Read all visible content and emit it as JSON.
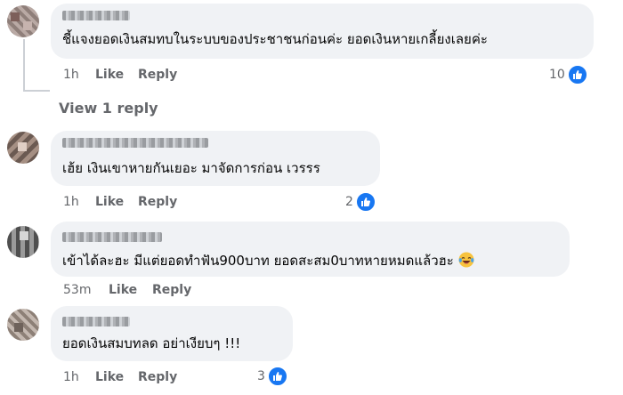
{
  "comments": [
    {
      "text": "ชี้แจงยอดเงินสมทบในระบบของประชาชนก่อนค่ะ ยอดเงินหายเกลี้ยงเลยค่ะ",
      "time": "1h",
      "like_label": "Like",
      "reply_label": "Reply",
      "reaction_count": "10"
    },
    {
      "text": "เฮ้ย เงินเขาหายกันเยอะ มาจัดการก่อน เวรรร",
      "time": "1h",
      "like_label": "Like",
      "reply_label": "Reply",
      "reaction_count": "2"
    },
    {
      "text": "เข้าได้ละฮะ มีแต่ยอดทำฟัน900บาท ยอดสะสม0บาทหายหมดแล้วฮะ",
      "emoji": "laughing-tears-emoji",
      "time": "53m",
      "like_label": "Like",
      "reply_label": "Reply"
    },
    {
      "text": "ยอดเงินสมบทลด อย่าเงียบๆ !!!",
      "time": "1h",
      "like_label": "Like",
      "reply_label": "Reply",
      "reaction_count": "3"
    }
  ],
  "view_replies": "View 1 reply",
  "colors": {
    "bubble": "#f0f2f5",
    "meta_text": "#65676b",
    "like_blue": "#1877f2",
    "thread_line": "#ccd0d5"
  },
  "icons": [
    "like-reaction-icon",
    "laughing-tears-emoji"
  ]
}
